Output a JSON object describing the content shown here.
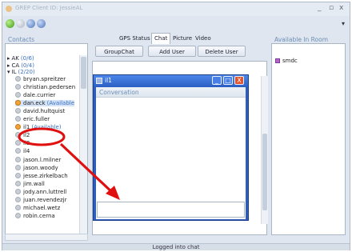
{
  "window": {
    "title": "GREP Client ID: JessieAL",
    "controls": [
      "_",
      "▫",
      "x"
    ]
  },
  "toolbar": {
    "icons": [
      "connect-icon",
      "status-icon",
      "settings-icon",
      "help-icon"
    ],
    "more_arrow": "▾"
  },
  "tabs": [
    {
      "label": "GPS Status",
      "active": false
    },
    {
      "label": "Chat",
      "active": true
    },
    {
      "label": "Picture",
      "active": false
    },
    {
      "label": "Video",
      "active": false
    }
  ],
  "contacts": {
    "header": "Contacts",
    "groups": [
      {
        "arrow": "▸",
        "name": "AK",
        "count": "(0/6)"
      },
      {
        "arrow": "▸",
        "name": "CA",
        "count": "(0/4)"
      },
      {
        "arrow": "▾",
        "name": "IL",
        "count": "(2/20)"
      }
    ],
    "items": [
      {
        "name": "bryan.spreitzer",
        "status": "",
        "online": false
      },
      {
        "name": "christian.pedersen",
        "status": "",
        "online": false
      },
      {
        "name": "dale.currier",
        "status": "",
        "online": false
      },
      {
        "name": "dan.eck",
        "status": "(Available",
        "online": true
      },
      {
        "name": "david.hultquist",
        "status": "",
        "online": false
      },
      {
        "name": "eric.fuller",
        "status": "",
        "online": false
      },
      {
        "name": "il1",
        "status": "(Available)",
        "online": true
      },
      {
        "name": "il2",
        "status": "",
        "online": false
      },
      {
        "name": "il3",
        "status": "",
        "online": false
      },
      {
        "name": "il4",
        "status": "",
        "online": false
      },
      {
        "name": "jason.l.milner",
        "status": "",
        "online": false
      },
      {
        "name": "jason.woody",
        "status": "",
        "online": false
      },
      {
        "name": "jesse.zirkelbach",
        "status": "",
        "online": false
      },
      {
        "name": "jim.wall",
        "status": "",
        "online": false
      },
      {
        "name": "jody.ann.luttrell",
        "status": "",
        "online": false
      },
      {
        "name": "juan.revendezjr",
        "status": "",
        "online": false
      },
      {
        "name": "michael.wetz",
        "status": "",
        "online": false
      },
      {
        "name": "robin.cerna",
        "status": "",
        "online": false
      }
    ]
  },
  "chat": {
    "buttons": {
      "groupchat": "GroupChat",
      "add_user": "Add User",
      "delete_user": "Delete User"
    }
  },
  "room": {
    "header": "Available In Room",
    "items": [
      "smdc"
    ]
  },
  "dialog": {
    "title": "il1",
    "header": "Conversation",
    "controls": [
      "_",
      "□",
      "X"
    ],
    "input_value": ""
  },
  "statusbar": {
    "text": "Logged into chat"
  },
  "colors": {
    "annotation": "#e01010",
    "online": "#f3a333",
    "accent": "#2e61c6"
  }
}
